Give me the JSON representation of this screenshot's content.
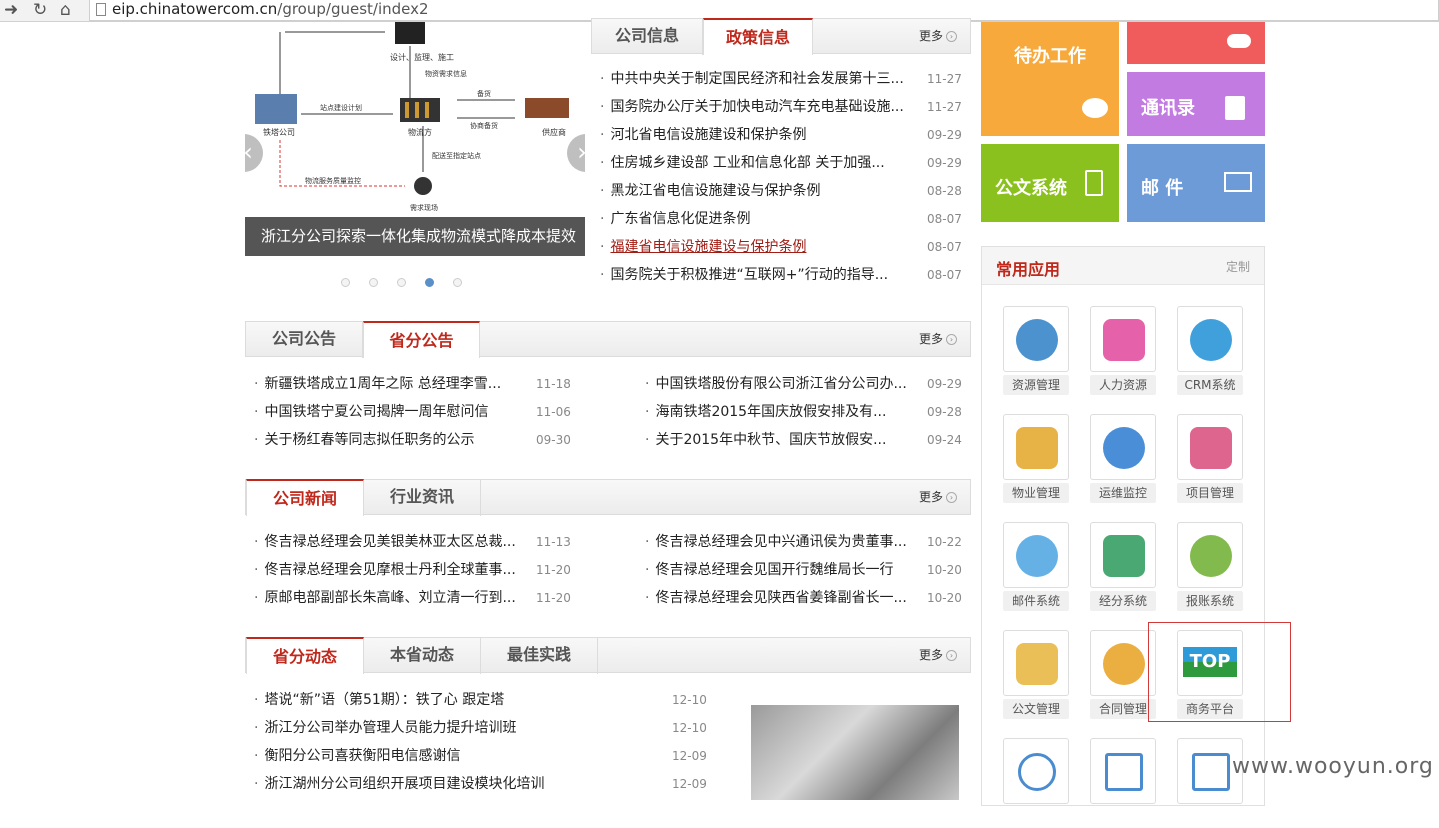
{
  "browser": {
    "url_domain": "eip.chinatowercom.cn",
    "url_path": "/group/guest/index2"
  },
  "slider": {
    "caption": "浙江分公司探索一体化集成物流模式降成本提效益",
    "diagram_labels": [
      "设计、监理、施工",
      "物资需求信息",
      "站点建设计划",
      "备货",
      "铁塔公司",
      "物流方",
      "协商备货",
      "供应商",
      "配送至指定站点",
      "物流服务质量监控",
      "需求现场"
    ]
  },
  "policy": {
    "tabs": [
      "公司信息",
      "政策信息"
    ],
    "more": "更多",
    "items": [
      {
        "title": "中共中央关于制定国民经济和社会发展第十三...",
        "date": "11-27"
      },
      {
        "title": "国务院办公厅关于加快电动汽车充电基础设施...",
        "date": "11-27"
      },
      {
        "title": "河北省电信设施建设和保护条例",
        "date": "09-29"
      },
      {
        "title": "住房城乡建设部 工业和信息化部 关于加强...",
        "date": "09-29"
      },
      {
        "title": "黑龙江省电信设施建设与保护条例",
        "date": "08-28"
      },
      {
        "title": "广东省信息化促进条例",
        "date": "08-07"
      },
      {
        "title": "福建省电信设施建设与保护条例",
        "date": "08-07"
      },
      {
        "title": "国务院关于积极推进“互联网+”行动的指导...",
        "date": "08-07"
      }
    ]
  },
  "notice": {
    "tabs": [
      "公司公告",
      "省分公告"
    ],
    "more": "更多",
    "left": [
      {
        "title": "新疆铁塔成立1周年之际 总经理李雪...",
        "date": "11-18"
      },
      {
        "title": "中国铁塔宁夏公司揭牌一周年慰问信",
        "date": "11-06"
      },
      {
        "title": "关于杨红春等同志拟任职务的公示",
        "date": "09-30"
      }
    ],
    "right": [
      {
        "title": "中国铁塔股份有限公司浙江省分公司办...",
        "date": "09-29"
      },
      {
        "title": "海南铁塔2015年国庆放假安排及有...",
        "date": "09-28"
      },
      {
        "title": "关于2015年中秋节、国庆节放假安...",
        "date": "09-24"
      }
    ]
  },
  "news": {
    "tabs": [
      "公司新闻",
      "行业资讯"
    ],
    "more": "更多",
    "left": [
      {
        "title": "佟吉禄总经理会见美银美林亚太区总裁...",
        "date": "11-13"
      },
      {
        "title": "佟吉禄总经理会见摩根士丹利全球董事...",
        "date": "11-20"
      },
      {
        "title": "原邮电部副部长朱高峰、刘立清一行到...",
        "date": "11-20"
      }
    ],
    "right": [
      {
        "title": "佟吉禄总经理会见中兴通讯侯为贵董事...",
        "date": "10-22"
      },
      {
        "title": "佟吉禄总经理会见国开行魏维局长一行",
        "date": "10-20"
      },
      {
        "title": "佟吉禄总经理会见陕西省姜锋副省长一...",
        "date": "10-20"
      }
    ]
  },
  "dynamics": {
    "tabs": [
      "省分动态",
      "本省动态",
      "最佳实践"
    ],
    "more": "更多",
    "items": [
      {
        "title": "塔说“新”语（第51期）：铁了心 跟定塔",
        "date": "12-10"
      },
      {
        "title": "浙江分公司举办管理人员能力提升培训班",
        "date": "12-10"
      },
      {
        "title": "衡阳分公司喜获衡阳电信感谢信",
        "date": "12-09"
      },
      {
        "title": "浙江湖州分公司组织开展项目建设模块化培训",
        "date": "12-09"
      }
    ]
  },
  "tiles": {
    "todo": "待办工作",
    "contacts": "通讯录",
    "docs": "公文系统",
    "mail": "邮 件"
  },
  "colors": {
    "orange": "#f7a93b",
    "red": "#f05b5b",
    "purple": "#c27be0",
    "green": "#8bc11e",
    "blue": "#6d9bd8",
    "accent": "#c0281c"
  },
  "apps": {
    "title": "常用应用",
    "customize": "定制",
    "items": [
      "资源管理",
      "人力资源",
      "CRM系统",
      "物业管理",
      "运维监控",
      "项目管理",
      "邮件系统",
      "经分系统",
      "报账系统",
      "公文管理",
      "合同管理",
      "商务平台"
    ],
    "top_logo": "TOP"
  },
  "watermark": "www.wooyun.org"
}
